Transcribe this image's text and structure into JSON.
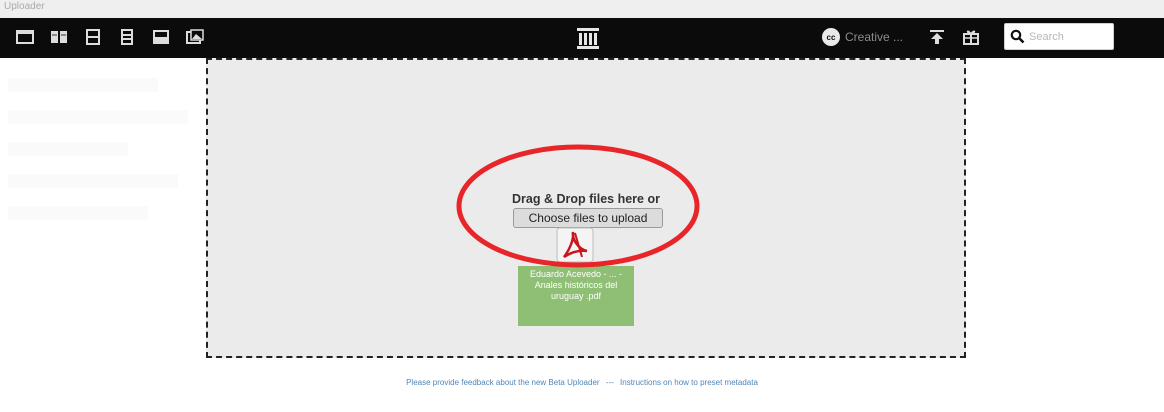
{
  "breadcrumb": "Uploader",
  "toolbar": {
    "license_label": "Creative ...",
    "license_badge": "cc",
    "search_placeholder": "Search",
    "icons": [
      "list-view-icon",
      "book-view-icon",
      "layout-one-icon",
      "layout-two-icon",
      "layout-three-icon",
      "image-view-icon",
      "archive-logo-icon",
      "upload-icon",
      "gift-icon",
      "search-icon"
    ]
  },
  "dropzone": {
    "prompt": "Drag & Drop files here or",
    "choose_label": "Choose files to upload",
    "file": {
      "name": "Eduardo Acevedo - ... - Anales históricos del uruguay .pdf",
      "icon": "pdf-file-icon"
    }
  },
  "annotation": {
    "shape": "ellipse",
    "color": "#e8262a"
  },
  "footer": {
    "feedback_link": "Please provide feedback about the new Beta Uploader",
    "separator": "---",
    "instructions_link": "Instructions on how to preset metadata"
  },
  "colors": {
    "toolbar_bg": "#0b0b0b",
    "dropzone_bg": "#ebebeb",
    "file_card_bg": "#8fbf74",
    "link": "#4f86b8",
    "annotation": "#e8262a"
  }
}
